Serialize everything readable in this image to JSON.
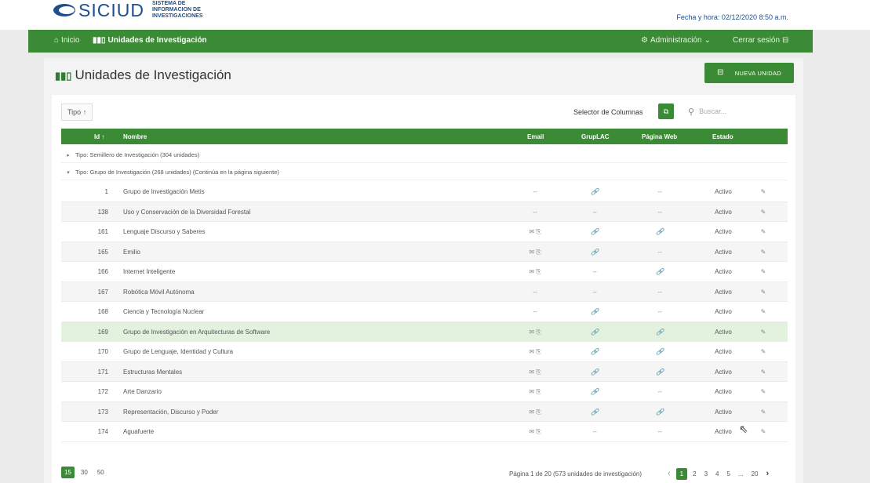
{
  "header": {
    "logo_text": "SICIUD",
    "logo_subtitle": "SISTEMA DE INFORMACION DE INVESTIGACIONES",
    "datetime": "Fecha y hora: 02/12/2020 8:50 a.m."
  },
  "nav": {
    "home": "Inicio",
    "units": "Unidades de Investigación",
    "admin": "Administración",
    "logout": "Cerrar sesión"
  },
  "page": {
    "title": "Unidades de Investigación",
    "new_button": "NUEVA UNIDAD"
  },
  "toolbar": {
    "group_chip": "Tipo",
    "column_selector": "Selector de Columnas",
    "search_placeholder": "Buscar..."
  },
  "table": {
    "headers": {
      "id": "Id",
      "name": "Nombre",
      "email": "Email",
      "gruplac": "GrupLAC",
      "web": "Página Web",
      "estado": "Estado"
    },
    "groups": [
      "Tipo: Semillero de Investigación (304 unidades)",
      "Tipo: Grupo de Investigación (268 unidades) (Continúa en la página siguiente)"
    ],
    "rows": [
      {
        "id": "1",
        "name": "Grupo de Investigación Metis",
        "email": "--",
        "gruplac": "🔗",
        "web": "--",
        "estado": "Activo"
      },
      {
        "id": "138",
        "name": "Uso y Conservación de la Diversidad Forestal",
        "email": "--",
        "gruplac": "--",
        "web": "--",
        "estado": "Activo"
      },
      {
        "id": "161",
        "name": "Lenguaje Discurso y Saberes",
        "email": "✉ ⎘",
        "gruplac": "🔗",
        "web": "🔗",
        "estado": "Activo"
      },
      {
        "id": "165",
        "name": "Emilio",
        "email": "✉ ⎘",
        "gruplac": "🔗",
        "web": "--",
        "estado": "Activo"
      },
      {
        "id": "166",
        "name": "Internet Inteligente",
        "email": "✉ ⎘",
        "gruplac": "--",
        "web": "🔗",
        "estado": "Activo"
      },
      {
        "id": "167",
        "name": "Robótica Móvil Autónoma",
        "email": "--",
        "gruplac": "--",
        "web": "--",
        "estado": "Activo"
      },
      {
        "id": "168",
        "name": "Ciencia y Tecnología Nuclear",
        "email": "--",
        "gruplac": "🔗",
        "web": "--",
        "estado": "Activo"
      },
      {
        "id": "169",
        "name": "Grupo de Investigación en Arquitecturas de Software",
        "email": "✉ ⎘",
        "gruplac": "🔗",
        "web": "🔗",
        "estado": "Activo"
      },
      {
        "id": "170",
        "name": "Grupo de Lenguaje, Identidad y Cultura",
        "email": "✉ ⎘",
        "gruplac": "🔗",
        "web": "🔗",
        "estado": "Activo"
      },
      {
        "id": "171",
        "name": "Estructuras Mentales",
        "email": "✉ ⎘",
        "gruplac": "🔗",
        "web": "🔗",
        "estado": "Activo"
      },
      {
        "id": "172",
        "name": "Arte Danzario",
        "email": "✉ ⎘",
        "gruplac": "🔗",
        "web": "--",
        "estado": "Activo"
      },
      {
        "id": "173",
        "name": "Representación, Discurso y Poder",
        "email": "✉ ⎘",
        "gruplac": "🔗",
        "web": "🔗",
        "estado": "Activo"
      },
      {
        "id": "174",
        "name": "Aguafuerte",
        "email": "✉ ⎘",
        "gruplac": "--",
        "web": "--",
        "estado": "Activo"
      }
    ]
  },
  "pagination": {
    "sizes": [
      "15",
      "30",
      "50"
    ],
    "info": "Página 1 de 20 (573 unidades de investigación)",
    "pages": [
      "1",
      "2",
      "3",
      "4",
      "5",
      "...",
      "20"
    ]
  },
  "colors": {
    "accent": "#3b8a35",
    "brand": "#1f4e8c",
    "highlight_row": "#e3f2df"
  },
  "icons": {
    "home": "home-icon",
    "units": "books-icon",
    "admin": "gear-icon",
    "logout": "logout-icon",
    "search": "search-icon",
    "edit": "edit-icon",
    "link": "link-icon",
    "email": "email-icon"
  }
}
